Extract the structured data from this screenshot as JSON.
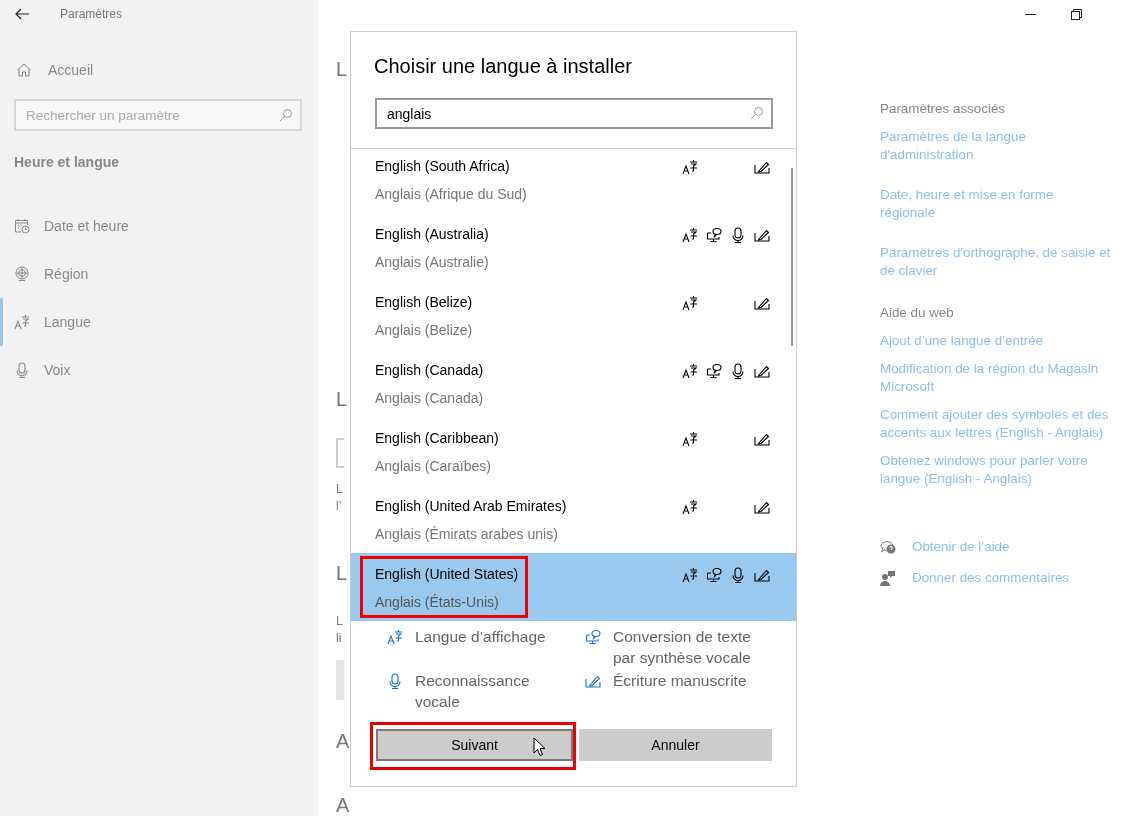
{
  "window": {
    "title": "Paramètres"
  },
  "sidebar": {
    "home": "Accueil",
    "search": {
      "placeholder": "Rechercher un paramètre"
    },
    "section": "Heure et langue",
    "items": [
      {
        "label": "Date et heure",
        "selected": false
      },
      {
        "label": "Région",
        "selected": false
      },
      {
        "label": "Langue",
        "selected": true
      },
      {
        "label": "Voix",
        "selected": false
      }
    ]
  },
  "background_fragments": [
    {
      "kind": "heading",
      "text": "L"
    },
    {
      "kind": "heading",
      "text": "L"
    },
    {
      "kind": "field"
    },
    {
      "kind": "text",
      "text": "L"
    },
    {
      "kind": "text",
      "text": "l’"
    },
    {
      "kind": "heading",
      "text": "L"
    },
    {
      "kind": "text",
      "text": "L"
    },
    {
      "kind": "text",
      "text": "li"
    },
    {
      "kind": "button"
    },
    {
      "kind": "heading",
      "text": "A"
    },
    {
      "kind": "heading",
      "text": "A"
    }
  ],
  "related": {
    "heading": "Paramètres associés",
    "links": [
      "Paramètres de la langue d'administration",
      "Date, heure et mise en forme régionale",
      "Paramètres d'orthographe, de saisie et de clavier"
    ]
  },
  "web_help": {
    "heading": "Aide du web",
    "links": [
      "Ajout d’une langue d’entrée",
      "Modification de la région du Magasin Microsoft",
      "Comment ajouter des symboles et des accents aux lettres (English - Anglais)",
      "Obtenez windows pour parler votre langue (English - Anglais)"
    ]
  },
  "support": [
    "Obtenir de l’aide",
    "Donner des commentaires"
  ],
  "dialog": {
    "title": "Choisir une langue à installer",
    "search": {
      "value": "anglais"
    },
    "languages": [
      {
        "name": "English (South Africa)",
        "native": "Anglais (Afrique du Sud)",
        "display": true,
        "tts": false,
        "speech": false,
        "handwriting": true,
        "selected": false,
        "highlighted": false
      },
      {
        "name": "English (Australia)",
        "native": "Anglais (Australie)",
        "display": true,
        "tts": true,
        "speech": true,
        "handwriting": true,
        "selected": false,
        "highlighted": false
      },
      {
        "name": "English (Belize)",
        "native": "Anglais (Belize)",
        "display": true,
        "tts": false,
        "speech": false,
        "handwriting": true,
        "selected": false,
        "highlighted": false
      },
      {
        "name": "English (Canada)",
        "native": "Anglais (Canada)",
        "display": true,
        "tts": true,
        "speech": true,
        "handwriting": true,
        "selected": false,
        "highlighted": false
      },
      {
        "name": "English (Caribbean)",
        "native": "Anglais (Caraïbes)",
        "display": true,
        "tts": false,
        "speech": false,
        "handwriting": true,
        "selected": false,
        "highlighted": false
      },
      {
        "name": "English (United Arab Emirates)",
        "native": "Anglais (Émirats arabes unis)",
        "display": true,
        "tts": false,
        "speech": false,
        "handwriting": true,
        "selected": false,
        "highlighted": false
      },
      {
        "name": "English (United States)",
        "native": "Anglais (États-Unis)",
        "display": true,
        "tts": true,
        "speech": true,
        "handwriting": true,
        "selected": true,
        "highlighted": true
      }
    ],
    "legend": [
      "Langue d’affichage",
      "Conversion de texte par synthèse vocale",
      "Reconnaissance vocale",
      "Écriture manuscrite"
    ],
    "buttons": [
      {
        "label": "Suivant",
        "kind": "primary",
        "highlighted": true
      },
      {
        "label": "Annuler",
        "kind": "secondary",
        "highlighted": false
      }
    ]
  }
}
